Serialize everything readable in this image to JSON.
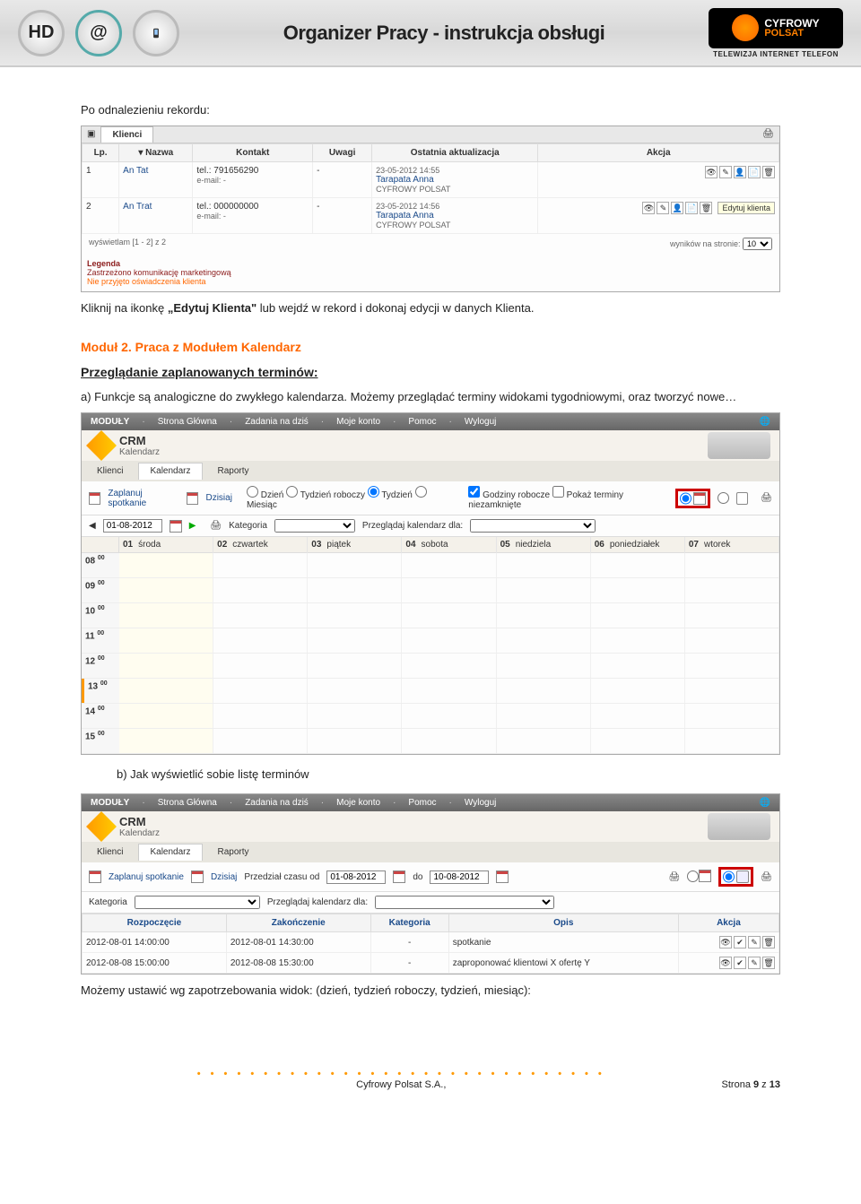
{
  "header": {
    "title": "Organizer Pracy - instrukcja obsługi",
    "brand1": "CYFROWY",
    "brand2": "POLSAT",
    "brand_sub": "TELEWIZJA INTERNET TELEFON"
  },
  "body": {
    "p1": "Po odnalezieniu rekordu:",
    "p2_a": "Kliknij na ikonkę ",
    "p2_bold": "„Edytuj Klienta\"",
    "p2_b": " lub wejdź w rekord i dokonaj edycji w danych Klienta.",
    "module_title": "Moduł 2. Praca z Modułem Kalendarz",
    "sub_title": "Przeglądanie zaplanowanych terminów:",
    "list_a": "a)  Funkcje są analogiczne do zwykłego kalendarza. Możemy przeglądać terminy widokami tygodniowymi, oraz tworzyć nowe…",
    "list_b": "b)  Jak wyświetlić sobie listę terminów",
    "p_last": "Możemy ustawić wg zapotrzebowania widok: (dzień, tydzień roboczy, tydzień, miesiąc):"
  },
  "clients": {
    "tab": "Klienci",
    "cols": {
      "lp": "Lp.",
      "nazwa": "▾ Nazwa",
      "kontakt": "Kontakt",
      "uwagi": "Uwagi",
      "ost": "Ostatnia aktualizacja",
      "akcja": "Akcja"
    },
    "rows": [
      {
        "lp": "1",
        "nazwa": "An Tat",
        "tel": "tel.: 791656290",
        "email": "e-mail: -",
        "uwagi": "-",
        "ts": "23-05-2012 14:55",
        "who": "Tarapata Anna",
        "firm": "CYFROWY POLSAT"
      },
      {
        "lp": "2",
        "nazwa": "An Trat",
        "tel": "tel.: 000000000",
        "email": "e-mail: -",
        "uwagi": "-",
        "ts": "23-05-2012 14:56",
        "who": "Tarapata Anna",
        "firm": "CYFROWY POLSAT"
      }
    ],
    "tooltip": "Edytuj klienta",
    "pager_left": "wyświetlam [1 - 2] z 2",
    "pager_right": "wyników na stronie:",
    "pager_val": "10",
    "legend_t": "Legenda",
    "legend_1": "Zastrzeżono komunikację marketingową",
    "legend_2": "Nie przyjęto oświadczenia klienta"
  },
  "crm": {
    "menu": {
      "moduly": "MODUŁY",
      "sg": "Strona Główna",
      "zd": "Zadania na dziś",
      "mk": "Moje konto",
      "pm": "Pomoc",
      "wy": "Wyloguj"
    },
    "title": "CRM",
    "subtitle": "Kalendarz",
    "tabs": {
      "klienci": "Klienci",
      "kalendarz": "Kalendarz",
      "raporty": "Raporty"
    },
    "toolbar": {
      "zaplanuj": "Zaplanuj spotkanie",
      "dzisiaj": "Dzisiaj",
      "dzien": "Dzień",
      "tr": "Tydzień roboczy",
      "tydzien": "Tydzień",
      "miesiac": "Miesiąc",
      "godziny": "Godziny robocze",
      "pokaz": "Pokaż terminy niezamknięte"
    },
    "date": "01-08-2012",
    "kategoria": "Kategoria",
    "przegladaj": "Przeglądaj kalendarz dla:",
    "days": [
      {
        "n": "01",
        "d": "środa"
      },
      {
        "n": "02",
        "d": "czwartek"
      },
      {
        "n": "03",
        "d": "piątek"
      },
      {
        "n": "04",
        "d": "sobota"
      },
      {
        "n": "05",
        "d": "niedziela"
      },
      {
        "n": "06",
        "d": "poniedziałek"
      },
      {
        "n": "07",
        "d": "wtorek"
      }
    ],
    "hours": [
      "08",
      "09",
      "10",
      "11",
      "12",
      "13",
      "14",
      "15"
    ]
  },
  "terms": {
    "przedzial_lbl": "Przedział czasu  od",
    "do_lbl": "do",
    "date_from": "01-08-2012",
    "date_to": "10-08-2012",
    "cols": {
      "r": "Rozpoczęcie",
      "z": "Zakończenie",
      "k": "Kategoria",
      "o": "Opis",
      "a": "Akcja"
    },
    "rows": [
      {
        "r": "2012-08-01 14:00:00",
        "z": "2012-08-01 14:30:00",
        "k": "-",
        "o": "spotkanie"
      },
      {
        "r": "2012-08-08 15:00:00",
        "z": "2012-08-08 15:30:00",
        "k": "-",
        "o": "zaproponować klientowi X ofertę Y"
      }
    ]
  },
  "footer": {
    "company": "Cyfrowy Polsat S.A.,",
    "page_a": "Strona ",
    "page_n": "9",
    "page_b": " z ",
    "page_t": "13"
  }
}
